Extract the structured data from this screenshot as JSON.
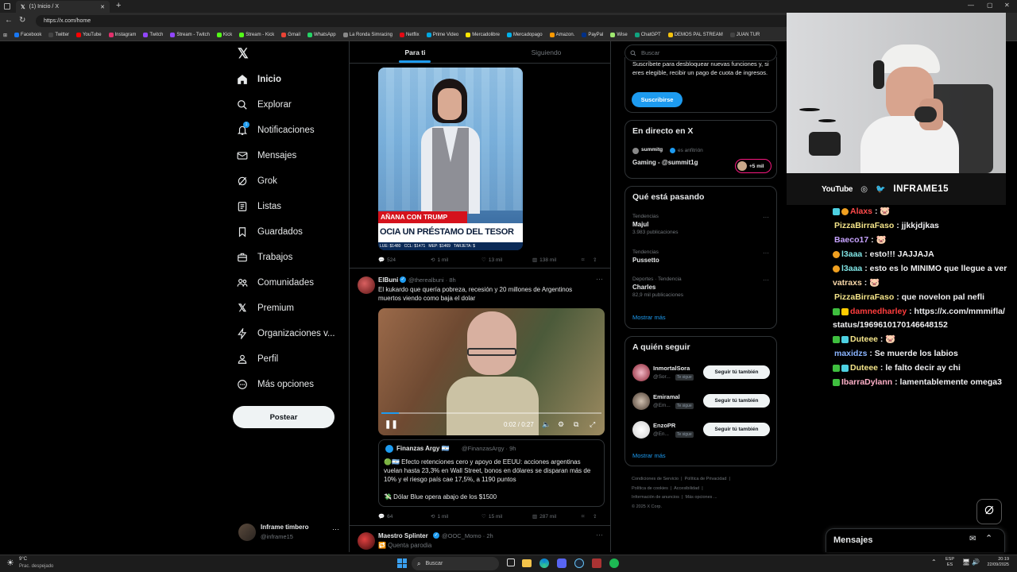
{
  "browser": {
    "tab_title": "(1) Inicio / X",
    "url": "https://x.com/home",
    "bookmarks": [
      "Facebook",
      "Twitter",
      "YouTube",
      "Instagram",
      "Twitch",
      "Stream - Twitch",
      "Kick",
      "Stream - Kick",
      "Gmail",
      "WhatsApp",
      "La Ronda Simracing",
      "Netflix",
      "Prime Video",
      "Mercadolibre",
      "Mercadopago",
      "Amazon.",
      "PayPal",
      "Wise",
      "ChatGPT",
      "DEMOS PAL STREAM",
      "JUAN TUR"
    ]
  },
  "nav": {
    "items": [
      {
        "label": "Inicio",
        "icon": "home-icon"
      },
      {
        "label": "Explorar",
        "icon": "search-icon"
      },
      {
        "label": "Notificaciones",
        "icon": "bell-icon"
      },
      {
        "label": "Mensajes",
        "icon": "mail-icon"
      },
      {
        "label": "Grok",
        "icon": "grok-icon"
      },
      {
        "label": "Listas",
        "icon": "list-icon"
      },
      {
        "label": "Guardados",
        "icon": "bookmark-icon"
      },
      {
        "label": "Trabajos",
        "icon": "briefcase-icon"
      },
      {
        "label": "Comunidades",
        "icon": "people-icon"
      },
      {
        "label": "Premium",
        "icon": "x-logo-icon"
      },
      {
        "label": "Organizaciones v...",
        "icon": "lightning-icon"
      },
      {
        "label": "Perfil",
        "icon": "person-icon"
      },
      {
        "label": "Más opciones",
        "icon": "more-circle-icon"
      }
    ],
    "notif_count": "1",
    "post_label": "Postear",
    "account_name": "Inframe timbero",
    "account_handle": "@inframe15"
  },
  "feed": {
    "tabs": [
      "Para ti",
      "Siguiendo"
    ],
    "tweet1": {
      "image_caption1": "AÑANA CON TRUMP",
      "image_caption2": "OCIA UN PRÉSTAMO DEL TESOR",
      "image_ticker": "LUE: $1480   CCL: $1471   MEP: $1469   TARJETA: $",
      "replies": "524",
      "reposts": "1 mil",
      "likes": "13 mil",
      "views": "138 mil"
    },
    "tweet2": {
      "name": "ElBuni",
      "handle": "@therealbuni · 8h",
      "text": "El kukardo que quería pobreza, recesión y 20 millones de Argentinos muertos viendo como baja el dolar",
      "video_time": "0:02 / 0:27",
      "quote_name": "Finanzas Argy 🇦🇷",
      "quote_handle": "@FinanzasArgy · 9h",
      "quote_text": "🟢🇦🇷 Efecto retenciones cero y apoyo de EEUU: acciones argentinas vuelan hasta 23,3% en Wall Street, bonos en dólares se disparan más de 10% y el riesgo país cae 17,5%, a 1190 puntos",
      "quote_text2": "💸 Dólar Blue opera abajo de los $1500",
      "replies": "64",
      "reposts": "1 mil",
      "likes": "15 mil",
      "views": "287 mil"
    },
    "tweet3": {
      "name": "Maestro Splinter",
      "handle": "@OOC_Momo · 2h",
      "text": "🔁 Quenta parodia"
    }
  },
  "right": {
    "search_placeholder": "Buscar",
    "premium_text": "Suscríbete para desbloquear nuevas funciones y, si eres elegible, recibir un pago de cuota de ingresos.",
    "subscribe_label": "Suscribirse",
    "live_title": "En directo en X",
    "live_host": "summitg",
    "live_host_role": "es anfitrión",
    "live_title_text": "Gaming - @summit1g",
    "live_count": "+5 mil",
    "trends_title": "Qué está pasando",
    "trends": [
      {
        "context": "Tendencias",
        "name": "Majul",
        "posts": "3.983 publicaciones"
      },
      {
        "context": "Tendencias",
        "name": "Pussetto",
        "posts": ""
      },
      {
        "context": "Deportes · Tendencia",
        "name": "Charles",
        "posts": "82,9 mil publicaciones"
      }
    ],
    "show_more": "Mostrar más",
    "follow_title": "A quién seguir",
    "follow": [
      {
        "name": "InmortalSora",
        "handle": "@Sor...",
        "tag": "Te sigue"
      },
      {
        "name": "Emiramal",
        "handle": "@Em...",
        "tag": "Te sigue"
      },
      {
        "name": "EnzoPR",
        "handle": "@En...",
        "tag": "Te sigue"
      }
    ],
    "follow_label": "Seguir tú también",
    "footer": [
      "Condiciones de Servicio",
      "Política de Privacidad",
      "Política de cookies",
      "Accesibilidad",
      "Información de anuncios",
      "Más opciones ...",
      "© 2025 X Corp."
    ],
    "messages_label": "Mensajes"
  },
  "stream": {
    "youtube": "YouTube",
    "channel": "INFRAME15"
  },
  "chat": [
    {
      "user": "Alaxs",
      "color": "#ff4a4a",
      "msg": " : 🐷"
    },
    {
      "user": "PizzaBirraFaso",
      "color": "#f5e58a",
      "msg": " : jjkkjdjkas"
    },
    {
      "user": "Baeco17",
      "color": "#c7a3ff",
      "msg": " : 🐷"
    },
    {
      "user": "l3aaa",
      "color": "#7fe3e3",
      "msg": " : esto!!! JAJJAJA"
    },
    {
      "user": "l3aaa",
      "color": "#7fe3e3",
      "msg": " : esto es lo MINIMO que llegue a ver"
    },
    {
      "user": "vatraxs",
      "color": "#f7d7a8",
      "msg": " : 🐷"
    },
    {
      "user": "PizzaBirraFaso",
      "color": "#f5e58a",
      "msg": " : que novelon pal nefli"
    },
    {
      "user": "damnedharley",
      "color": "#ff3d3d",
      "msg": " : https://x.com/mmmifla/status/1969610170146648152"
    },
    {
      "user": "Duteee",
      "color": "#f5e58a",
      "msg": " : 🐷"
    },
    {
      "user": "maxidzs",
      "color": "#8ab4ff",
      "msg": " : Se muerde los labios"
    },
    {
      "user": "Duteee",
      "color": "#f5e58a",
      "msg": " : le falto decir ay chi"
    },
    {
      "user": "IbarraDylann",
      "color": "#ffb0c8",
      "msg": " : lamentablemente omega3"
    }
  ],
  "taskbar": {
    "weather_temp": "9°C",
    "weather_desc": "Prac. despejado",
    "search": "Buscar",
    "lang": "ESP",
    "lang2": "ES",
    "time": "20:19",
    "date": "22/09/2025"
  }
}
